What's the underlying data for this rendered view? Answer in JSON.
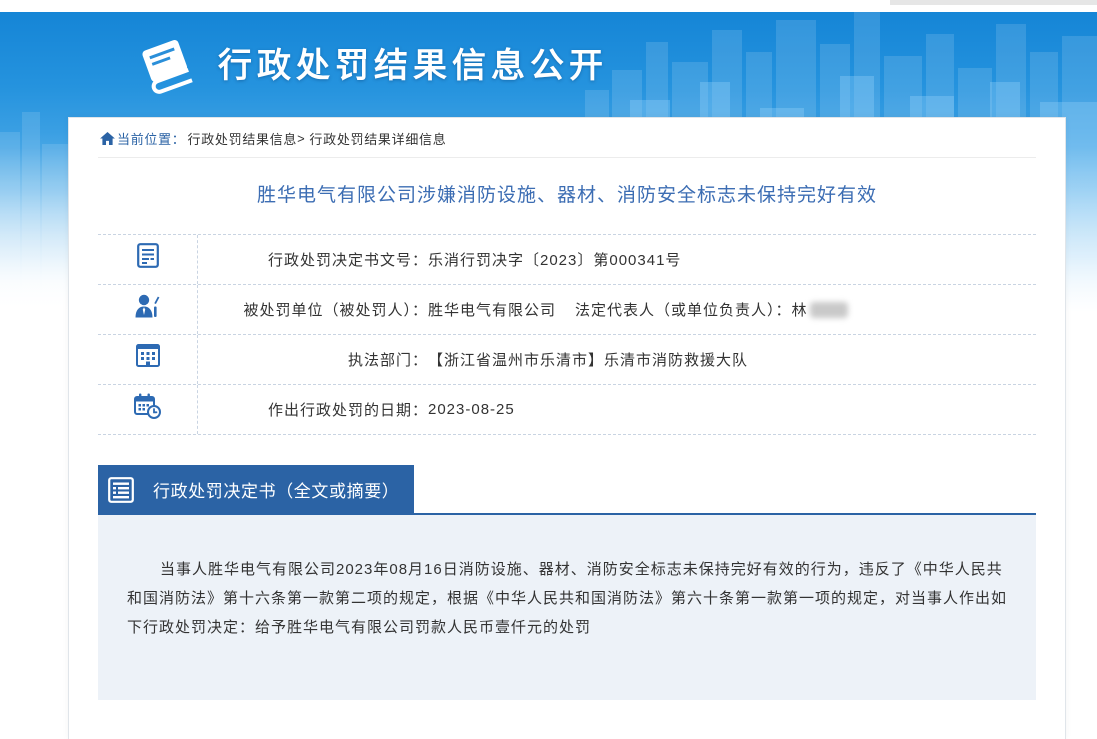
{
  "banner": {
    "title": "行政处罚结果信息公开",
    "icon": "book-icon"
  },
  "breadcrumb": {
    "icon": "home-icon",
    "label": "当前位置：",
    "items": [
      "行政处罚结果信息",
      "行政处罚结果详细信息"
    ],
    "separator": ">"
  },
  "title": "胜华电气有限公司涉嫌消防设施、器材、消防安全标志未保持完好有效",
  "info_rows": [
    {
      "icon": "document-icon",
      "label": "行政处罚决定书文号：",
      "value": "乐消行罚决字〔2023〕第000341号"
    },
    {
      "icon": "person-icon",
      "label": "被处罚单位（被处罚人）：",
      "value": "胜华电气有限公司",
      "extra_label": "法定代表人（或单位负责人）：",
      "extra_value": "林"
    },
    {
      "icon": "building-icon",
      "label": "执法部门：",
      "value": "【浙江省温州市乐清市】乐清市消防救援大队"
    },
    {
      "icon": "calendar-icon",
      "label": "作出行政处罚的日期：",
      "value": "2023-08-25"
    }
  ],
  "decision": {
    "icon": "list-icon",
    "heading": "行政处罚决定书（全文或摘要）",
    "text": "当事人胜华电气有限公司2023年08月16日消防设施、器材、消防安全标志未保持完好有效的行为，违反了《中华人民共和国消防法》第十六条第一款第二项的规定，根据《中华人民共和国消防法》第六十条第一款第一项的规定，对当事人作出如下行政处罚决定：给予胜华电气有限公司罚款人民币壹仟元的处罚"
  },
  "colors": {
    "banner_blue": "#1585d6",
    "primary": "#2b63a5",
    "title_blue": "#3c6db3",
    "icon_blue": "#2d6ab3",
    "body_background": "#edf2f8"
  }
}
